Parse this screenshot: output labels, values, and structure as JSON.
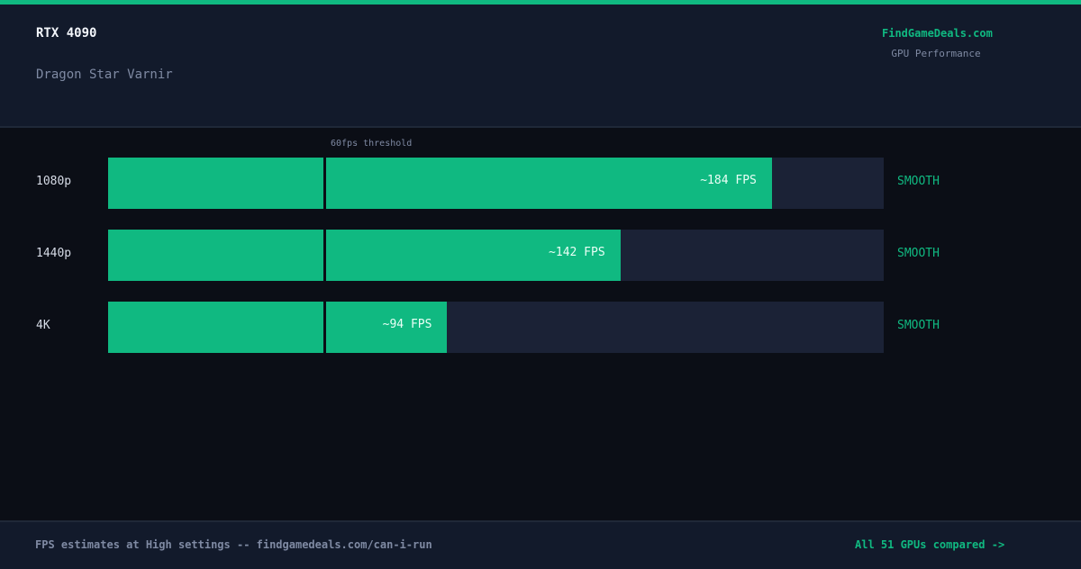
{
  "header": {
    "gpu": "RTX 4090",
    "game": "Dragon Star Varnir",
    "brand": "FindGameDeals.com",
    "brand_sub": "GPU Performance"
  },
  "chart_data": {
    "type": "bar",
    "orientation": "horizontal",
    "categories": [
      "1080p",
      "1440p",
      "4K"
    ],
    "values": [
      184,
      142,
      94
    ],
    "value_labels": [
      "~184 FPS",
      "~142 FPS",
      "~94 FPS"
    ],
    "status": [
      "SMOOTH",
      "SMOOTH",
      "SMOOTH"
    ],
    "xlim": [
      0,
      215
    ],
    "threshold": {
      "value": 60,
      "label": "60fps threshold"
    },
    "colors": {
      "bar": "#10b981",
      "track": "#1b2236",
      "status": "#10b981"
    }
  },
  "footer": {
    "left": "FPS estimates at High settings -- findgamedeals.com/can-i-run",
    "right": "All 51 GPUs compared ->"
  }
}
